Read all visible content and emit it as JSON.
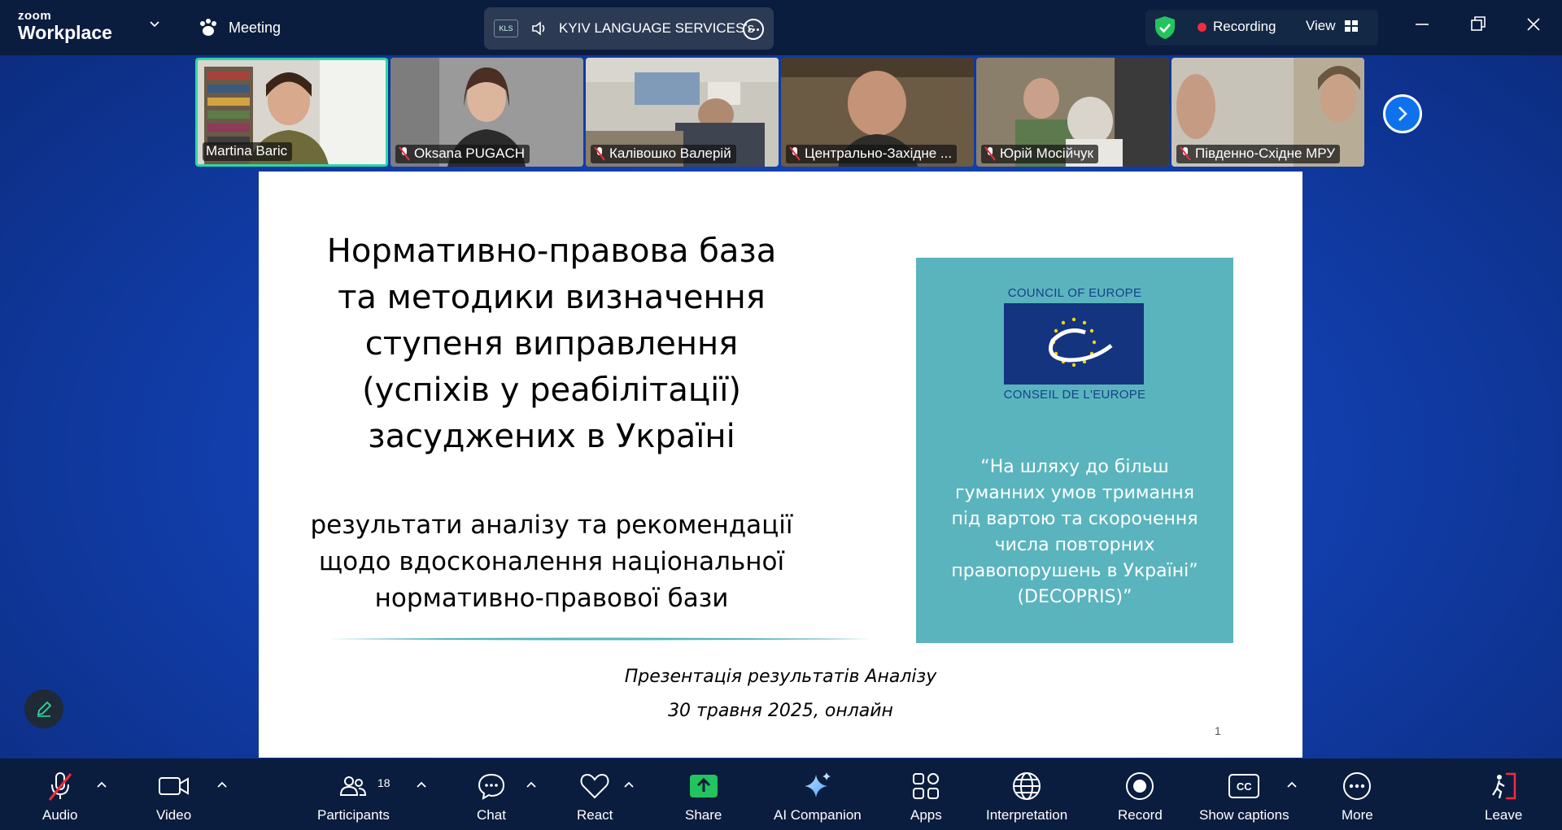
{
  "app": {
    "brand_small": "zoom",
    "brand_large": "Workplace",
    "meeting_label": "Meeting"
  },
  "share": {
    "badge": "KLS",
    "title": "KYIV LANGUAGE SERVICES's"
  },
  "status": {
    "recording_label": "Recording",
    "view_label": "View"
  },
  "colors": {
    "accent": "#0e72ed",
    "active_speaker": "#2dd8a2",
    "recording": "#f22c3d",
    "slide_panel": "#5ab4bd"
  },
  "participants": [
    {
      "name": "Martina Baric",
      "muted": false
    },
    {
      "name": "Oksana PUGACH",
      "muted": true
    },
    {
      "name": "Калівошко Валерій",
      "muted": true
    },
    {
      "name": "Центрально-Західне ...",
      "muted": true
    },
    {
      "name": "Юрій Мосійчук",
      "muted": true
    },
    {
      "name": "Південно-Східне МРУ",
      "muted": true
    }
  ],
  "slide": {
    "title": "Нормативно-правова база та методики визначення ступеня виправлення (успіхів у реабілітації) засуджених в Україні",
    "subtitle": "результати аналізу та рекомендації щодо вдосконалення національної нормативно-правової бази",
    "coe_top": "COUNCIL OF EUROPE",
    "coe_bottom": "CONSEIL DE L'EUROPE",
    "quote": "“На шляху до більш гуманних умов тримання під вартою та скорочення числа повторних правопорушень в Україні” (DECOPRIS)”",
    "presentation_line1": "Презентація результатів Аналізу",
    "presentation_line2": "30 травня 2025, онлайн",
    "page_number": "1"
  },
  "toolbar": {
    "audio": "Audio",
    "video": "Video",
    "participants": "Participants",
    "participants_count": "18",
    "chat": "Chat",
    "react": "React",
    "share": "Share",
    "ai_companion": "AI Companion",
    "apps": "Apps",
    "interpretation": "Interpretation",
    "record": "Record",
    "show_captions": "Show captions",
    "captions_badge": "CC",
    "more": "More",
    "leave": "Leave"
  }
}
